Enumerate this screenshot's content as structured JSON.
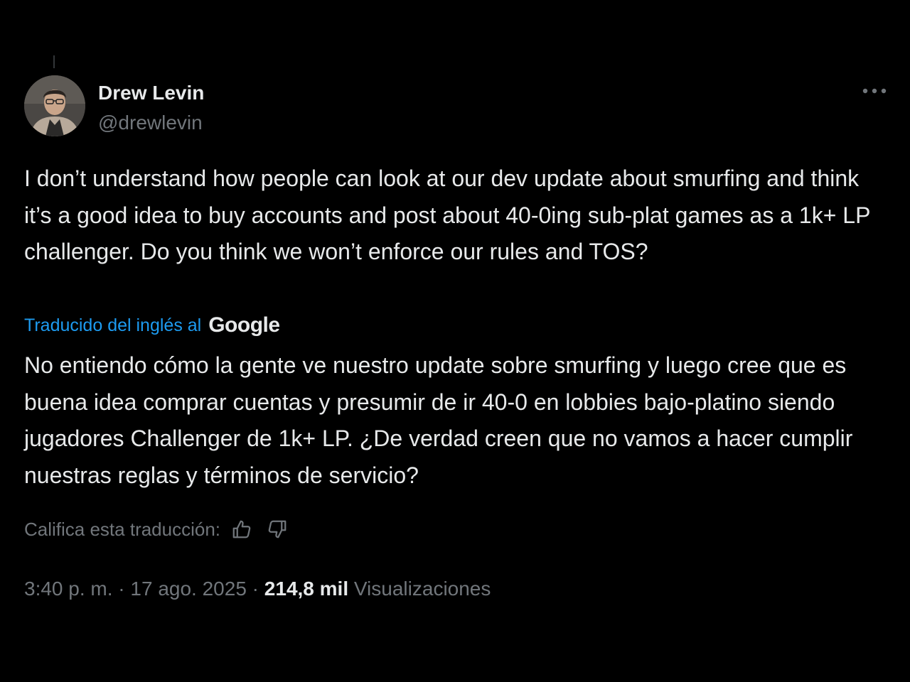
{
  "author": {
    "display_name": "Drew Levin",
    "handle": "@drewlevin",
    "avatar_icon": "profile-photo"
  },
  "more_options_icon": "more-horizontal-icon",
  "tweet": {
    "text": "I don’t understand how people can look at our dev update about smurfing and think it’s a good idea to buy accounts and post about 40-0ing sub-plat games as a 1k+ LP challenger. Do you think we won’t enforce our rules and TOS?"
  },
  "translation": {
    "label": "Traducido del inglés al",
    "provider": "Google",
    "text": "No entiendo cómo la gente ve nuestro update sobre smurfing y luego cree que es buena idea comprar cuentas y presumir de ir 40-0 en lobbies bajo-platino siendo jugadores Challenger de 1k+ LP. ¿De verdad creen que no vamos a hacer cumplir nuestras reglas y términos de servicio?",
    "rate_label": "Califica esta traducción:",
    "rate_up_icon": "thumbs-up-icon",
    "rate_down_icon": "thumbs-down-icon"
  },
  "meta": {
    "time": "3:40 p. m.",
    "separator": " · ",
    "date": "17 ago. 2025",
    "views_count": "214,8 mil",
    "views_label": "Visualizaciones"
  },
  "colors": {
    "background": "#000000",
    "text_primary": "#e7e9ea",
    "text_secondary": "#71767b",
    "link": "#1d9bf0"
  }
}
